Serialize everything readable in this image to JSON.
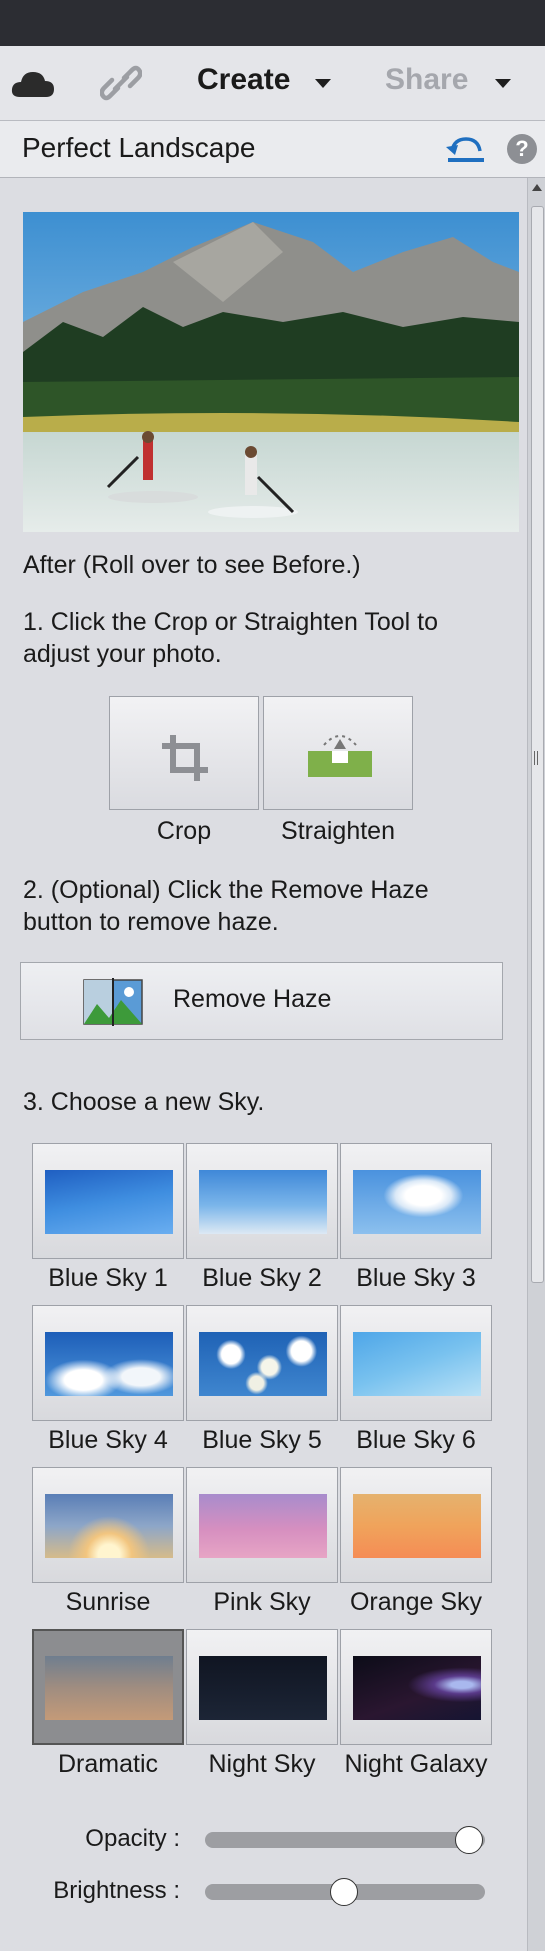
{
  "toolbar": {
    "cloud_icon": "cloud-icon",
    "link_icon": "link-icon",
    "create_label": "Create",
    "share_label": "Share"
  },
  "panel": {
    "title": "Perfect Landscape",
    "reset_icon": "reset-icon",
    "help_icon": "help-icon",
    "after_text": "After (Roll over to see Before.)",
    "step1_text": "1. Click the Crop or Straighten Tool to adjust your photo.",
    "crop_label": "Crop",
    "straighten_label": "Straighten",
    "step2_text": "2. (Optional) Click the Remove Haze button to remove haze.",
    "remove_haze_label": "Remove Haze",
    "step3_text": "3. Choose a new Sky.",
    "skies": [
      {
        "label": "Blue Sky 1"
      },
      {
        "label": "Blue Sky 2"
      },
      {
        "label": "Blue Sky 3"
      },
      {
        "label": "Blue Sky 4"
      },
      {
        "label": "Blue Sky 5"
      },
      {
        "label": "Blue Sky 6"
      },
      {
        "label": "Sunrise"
      },
      {
        "label": "Pink Sky"
      },
      {
        "label": "Orange Sky"
      },
      {
        "label": "Dramatic",
        "selected": true
      },
      {
        "label": "Night Sky"
      },
      {
        "label": "Night Galaxy"
      }
    ],
    "opacity_label": "Opacity :",
    "opacity_value": 1.0,
    "brightness_label": "Brightness :",
    "brightness_value": 0.5
  },
  "colors": {
    "accent_blue": "#1f6fc0",
    "panel_bg": "#dcdde2"
  }
}
